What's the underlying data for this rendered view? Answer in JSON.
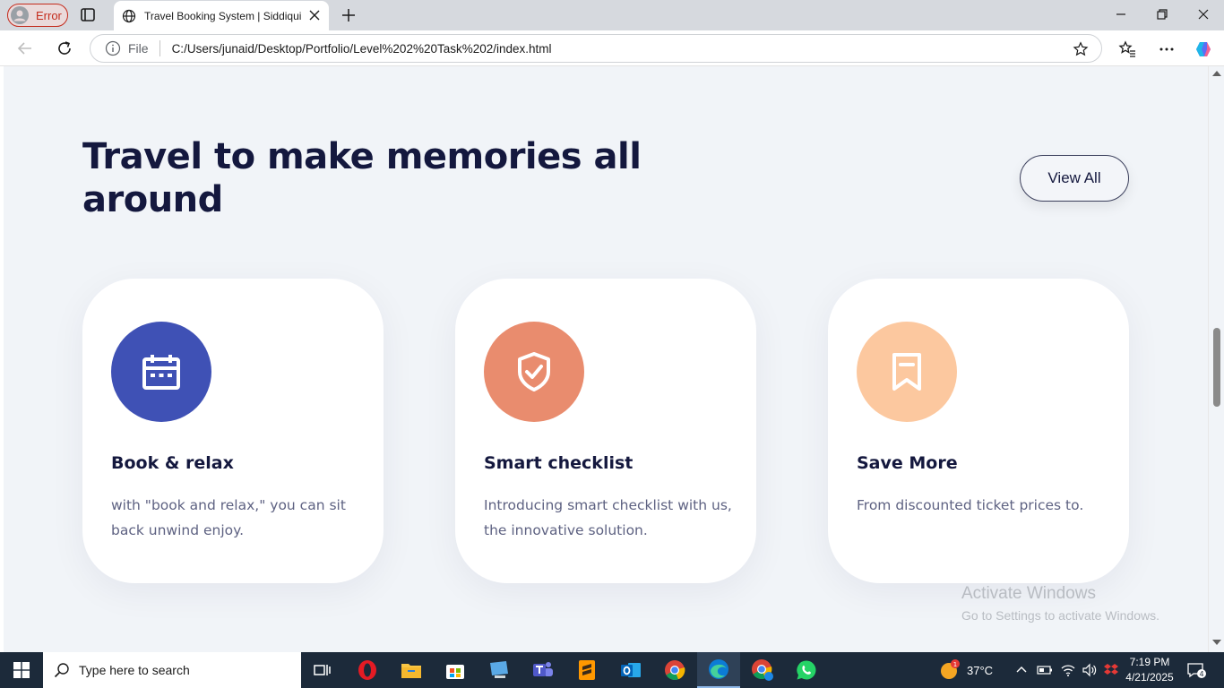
{
  "browser": {
    "profile_label": "Error",
    "tab_title": "Travel Booking System | Siddiqui",
    "address": {
      "scheme_label": "File",
      "url": "C:/Users/junaid/Desktop/Portfolio/Level%202%20Task%202/index.html"
    }
  },
  "page": {
    "headline": "Travel to make memories all around",
    "view_all_label": "View All",
    "cards": [
      {
        "title": "Book & relax",
        "description": "with \"book and relax,\" you can sit back unwind enjoy.",
        "icon": "calendar-icon",
        "color": "#3f51b5"
      },
      {
        "title": "Smart checklist",
        "description": "Introducing smart checklist with us, the innovative solution.",
        "icon": "shield-check-icon",
        "color": "#e98c6e"
      },
      {
        "title": "Save More",
        "description": "From discounted ticket prices to.",
        "icon": "bookmark-icon",
        "color": "#fcc89f"
      }
    ]
  },
  "watermark": {
    "line1": "Activate Windows",
    "line2": "Go to Settings to activate Windows."
  },
  "taskbar": {
    "search_placeholder": "Type here to search",
    "weather": "37°C",
    "weather_badge": "1",
    "time": "7:19 PM",
    "date": "4/21/2025",
    "notification_count": "4"
  }
}
